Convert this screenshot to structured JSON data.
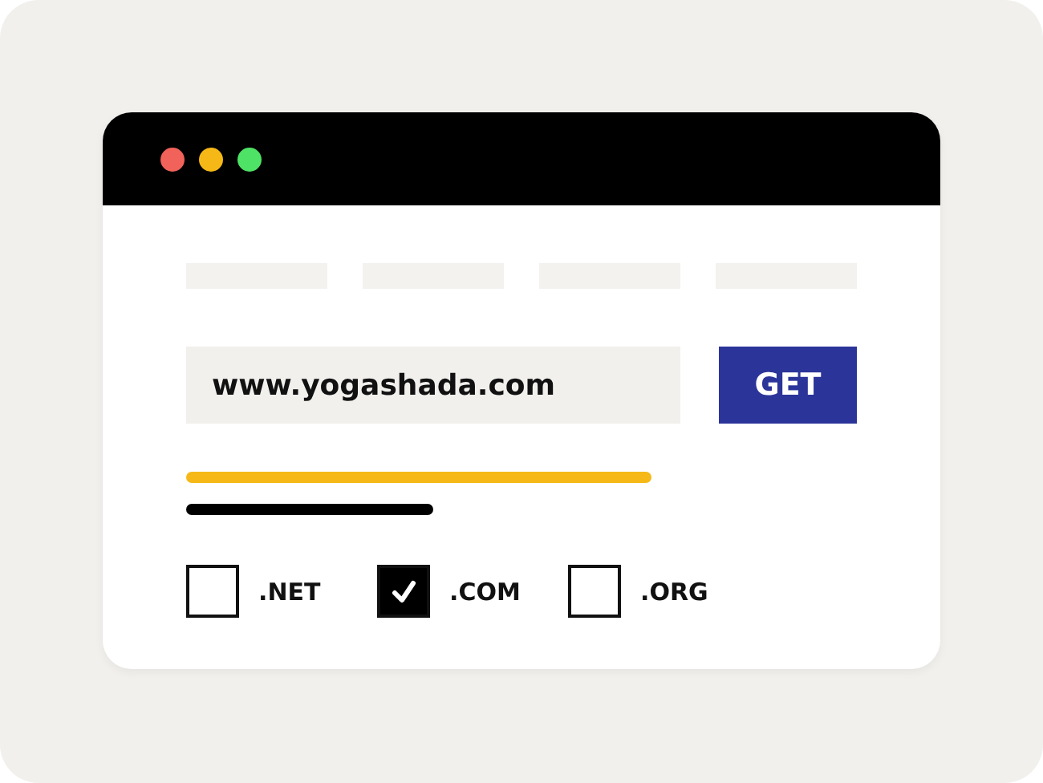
{
  "window": {
    "controls": [
      {
        "color": "#f0625a"
      },
      {
        "color": "#f5b817"
      },
      {
        "color": "#4ee266"
      }
    ]
  },
  "domain_field": {
    "value": "www.yogashada.com"
  },
  "get_button": {
    "label": "GET"
  },
  "extensions": [
    {
      "label": ".NET",
      "checked": false
    },
    {
      "label": ".COM",
      "checked": true
    },
    {
      "label": ".ORG",
      "checked": false
    }
  ]
}
